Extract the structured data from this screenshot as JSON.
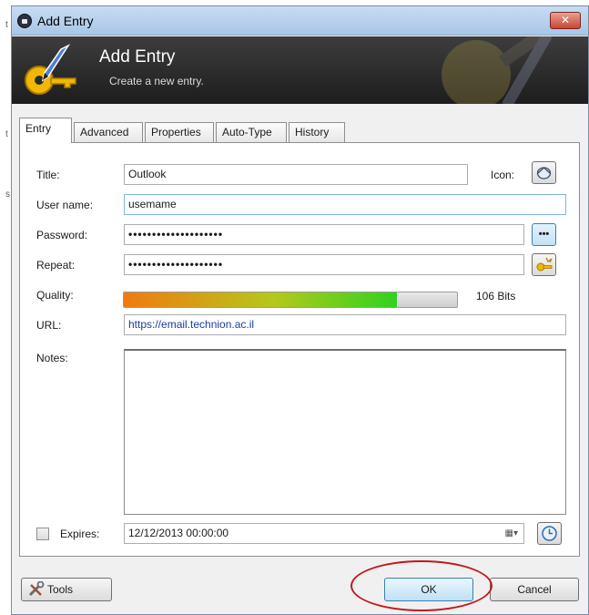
{
  "window": {
    "title": "Add Entry",
    "close_glyph": "✕"
  },
  "banner": {
    "title": "Add Entry",
    "subtitle": "Create a new entry."
  },
  "tabs": [
    {
      "label": "Entry",
      "active": true
    },
    {
      "label": "Advanced",
      "active": false
    },
    {
      "label": "Properties",
      "active": false
    },
    {
      "label": "Auto-Type",
      "active": false
    },
    {
      "label": "History",
      "active": false
    }
  ],
  "form": {
    "title_label": "Title:",
    "title_value": "Outlook",
    "icon_label": "Icon:",
    "username_label": "User name:",
    "username_value": "usemame",
    "password_label": "Password:",
    "password_value": "••••••••••••••••••••",
    "repeat_label": "Repeat:",
    "repeat_value": "••••••••••••••••••••",
    "reveal_glyph": "•••",
    "quality_label": "Quality:",
    "quality_fraction": 0.82,
    "quality_text": "106 Bits",
    "url_label": "URL:",
    "url_value": "https://email.technion.ac.il",
    "notes_label": "Notes:",
    "notes_value": "",
    "expires_label": "Expires:",
    "expires_checked": false,
    "expires_value": "12/12/2013 00:00:00"
  },
  "footer": {
    "tools_label": "Tools",
    "ok_label": "OK",
    "cancel_label": "Cancel"
  },
  "icons": {
    "app": "lock-icon",
    "banner": "key-pen-icon",
    "entry_icon": "entry-icon",
    "reveal": "reveal-password-icon",
    "generate": "password-generator-icon",
    "calendar": "calendar-dropdown-icon",
    "expiry": "clock-icon",
    "tools": "tools-icon"
  },
  "colors": {
    "banner": "#2a2a2a",
    "quality_start": "#f07a10",
    "quality_end": "#2ed31e",
    "highlight": "#c4161c",
    "url_text": "#1a3c9e"
  },
  "left_edge_glyphs": [
    "t",
    "t",
    "s"
  ]
}
